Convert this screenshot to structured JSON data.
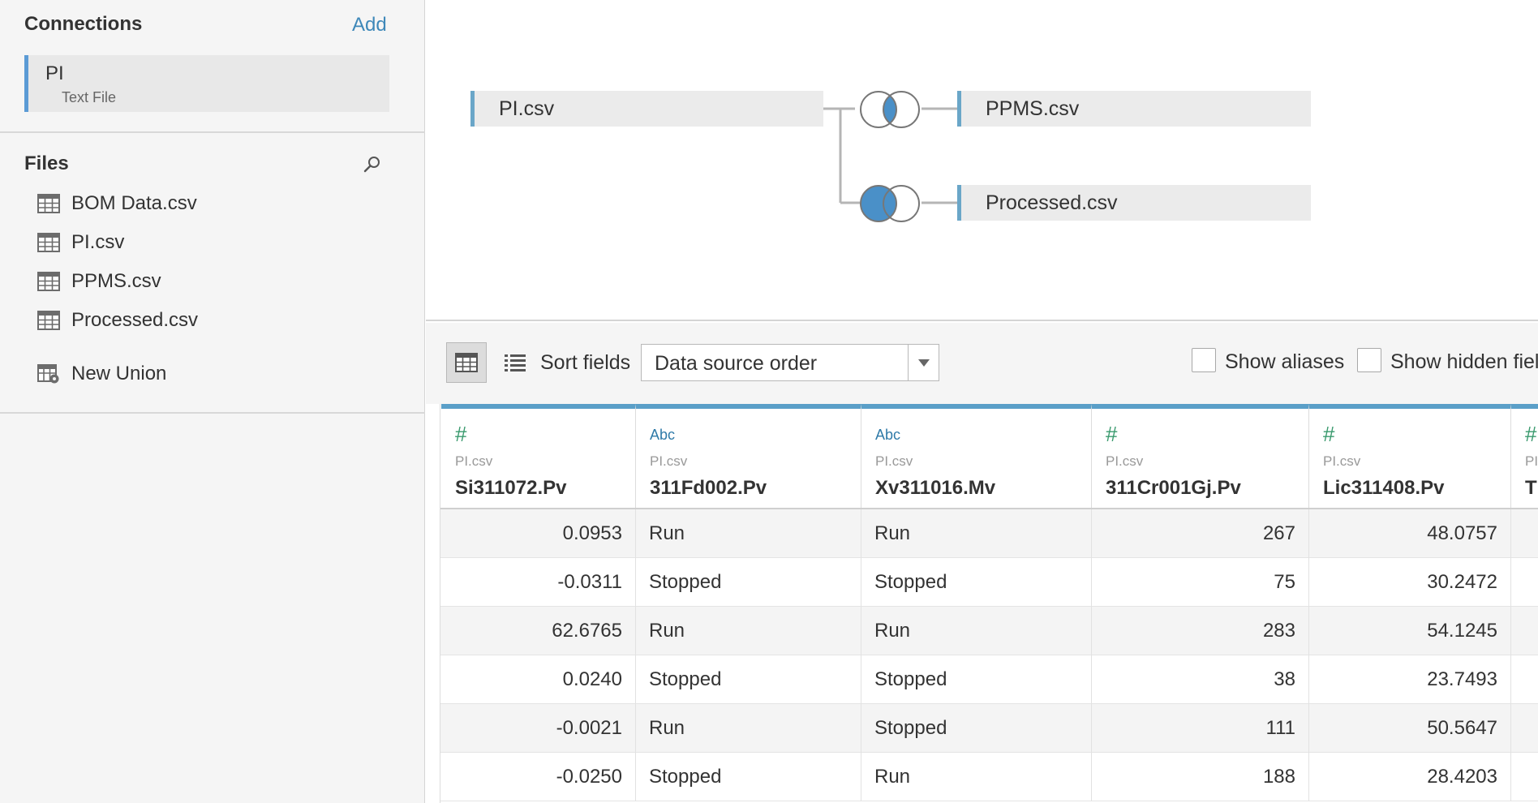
{
  "sidebar": {
    "connections_title": "Connections",
    "add_label": "Add",
    "connection": {
      "name": "PI",
      "type": "Text File"
    },
    "files_title": "Files",
    "files": [
      {
        "label": "BOM Data.csv",
        "icon": "table-icon"
      },
      {
        "label": "PI.csv",
        "icon": "table-icon"
      },
      {
        "label": "PPMS.csv",
        "icon": "table-icon"
      },
      {
        "label": "Processed.csv",
        "icon": "table-icon"
      }
    ],
    "new_union": {
      "label": "New Union",
      "icon": "new-union-icon"
    }
  },
  "canvas": {
    "left_table": "PI.csv",
    "joins": [
      {
        "table": "PPMS.csv",
        "join_type": "inner",
        "icon": "inner-join-icon"
      },
      {
        "table": "Processed.csv",
        "join_type": "left",
        "icon": "left-join-icon"
      }
    ]
  },
  "toolbar": {
    "sort_label": "Sort fields",
    "sort_value": "Data source order",
    "show_aliases_label": "Show aliases",
    "show_hidden_label": "Show hidden fiel"
  },
  "grid": {
    "columns": [
      {
        "type": "#",
        "source": "PI.csv",
        "name": "Si311072.Pv",
        "align": "right"
      },
      {
        "type": "Abc",
        "source": "PI.csv",
        "name": "311Fd002.Pv",
        "align": "left"
      },
      {
        "type": "Abc",
        "source": "PI.csv",
        "name": "Xv311016.Mv",
        "align": "left"
      },
      {
        "type": "#",
        "source": "PI.csv",
        "name": "311Cr001Gj.Pv",
        "align": "right"
      },
      {
        "type": "#",
        "source": "PI.csv",
        "name": "Lic311408.Pv",
        "align": "right"
      },
      {
        "type": "#",
        "source": "PI.csv",
        "name": "T",
        "align": "right"
      }
    ],
    "rows": [
      [
        "0.0953",
        "Run",
        "Run",
        "267",
        "48.0757",
        ""
      ],
      [
        "-0.0311",
        "Stopped",
        "Stopped",
        "75",
        "30.2472",
        ""
      ],
      [
        "62.6765",
        "Run",
        "Run",
        "283",
        "54.1245",
        ""
      ],
      [
        "0.0240",
        "Stopped",
        "Stopped",
        "38",
        "23.7493",
        ""
      ],
      [
        "-0.0021",
        "Run",
        "Stopped",
        "111",
        "50.5647",
        ""
      ],
      [
        "-0.0250",
        "Stopped",
        "Run",
        "188",
        "28.4203",
        ""
      ]
    ]
  },
  "colors": {
    "accent_blue": "#5a9fc8",
    "join_fill": "#4a90c8",
    "link_blue": "#3e88b9",
    "number_type_green": "#3a9a6e"
  }
}
